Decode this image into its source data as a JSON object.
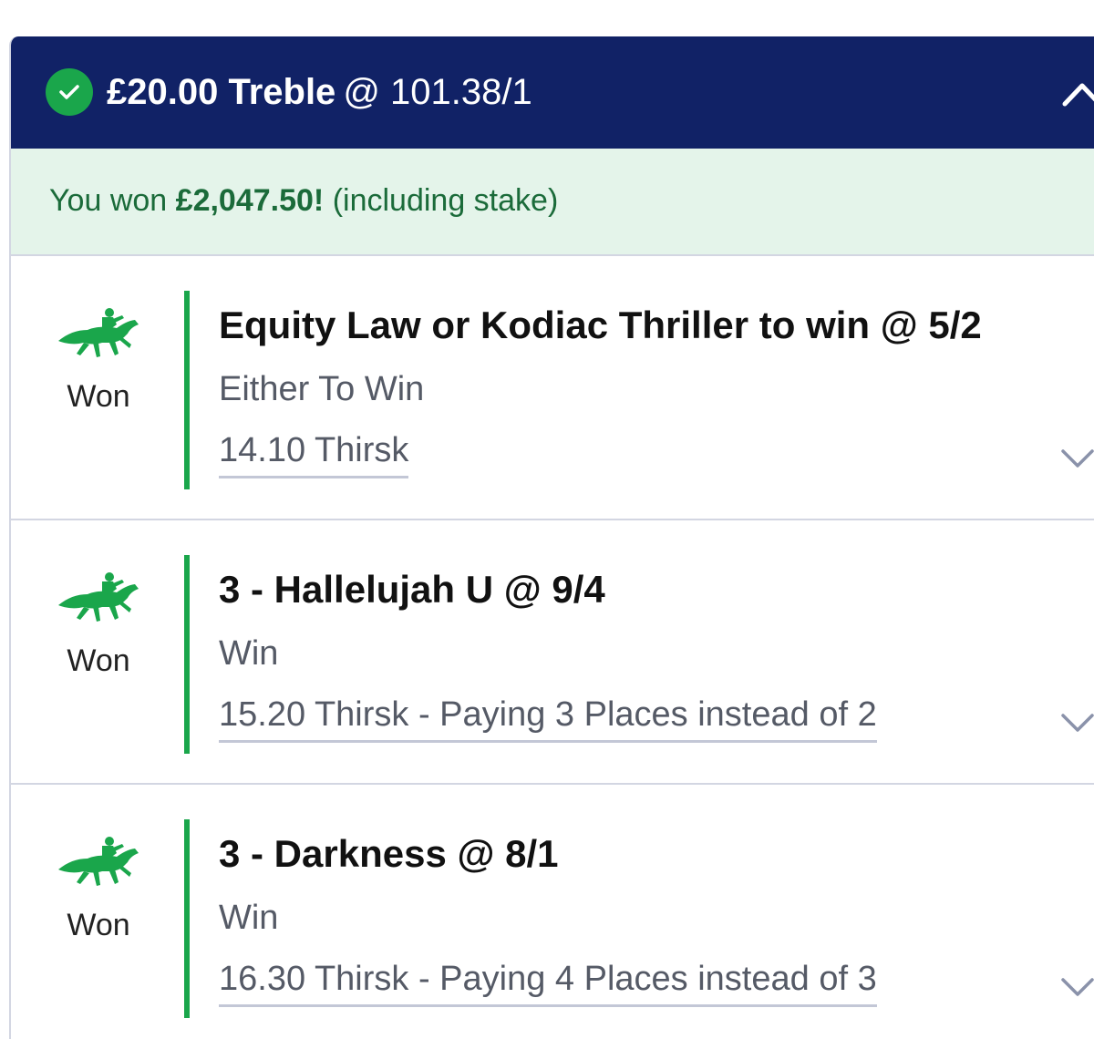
{
  "bet": {
    "stake": "£20.00",
    "type": "Treble",
    "odds": "@ 101.38/1",
    "status_icon": "check-circle-icon",
    "colors": {
      "header_bg": "#112266",
      "won_green": "#1aa64b",
      "banner_bg": "#e4f4ea"
    }
  },
  "banner": {
    "prefix": "You won",
    "amount": "£2,047.50!",
    "suffix": "(including stake)"
  },
  "selections": [
    {
      "icon": "horse-racing-icon",
      "status": "Won",
      "title": "Equity Law or Kodiac Thriller to win @ 5/2",
      "market": "Either To Win",
      "event": "14.10 Thirsk"
    },
    {
      "icon": "horse-racing-icon",
      "status": "Won",
      "title": "3 - Hallelujah U @ 9/4",
      "market": "Win",
      "event": "15.20 Thirsk - Paying 3 Places instead of 2"
    },
    {
      "icon": "horse-racing-icon",
      "status": "Won",
      "title": "3 - Darkness @ 8/1",
      "market": "Win",
      "event": "16.30 Thirsk - Paying 4 Places instead of 3"
    }
  ]
}
